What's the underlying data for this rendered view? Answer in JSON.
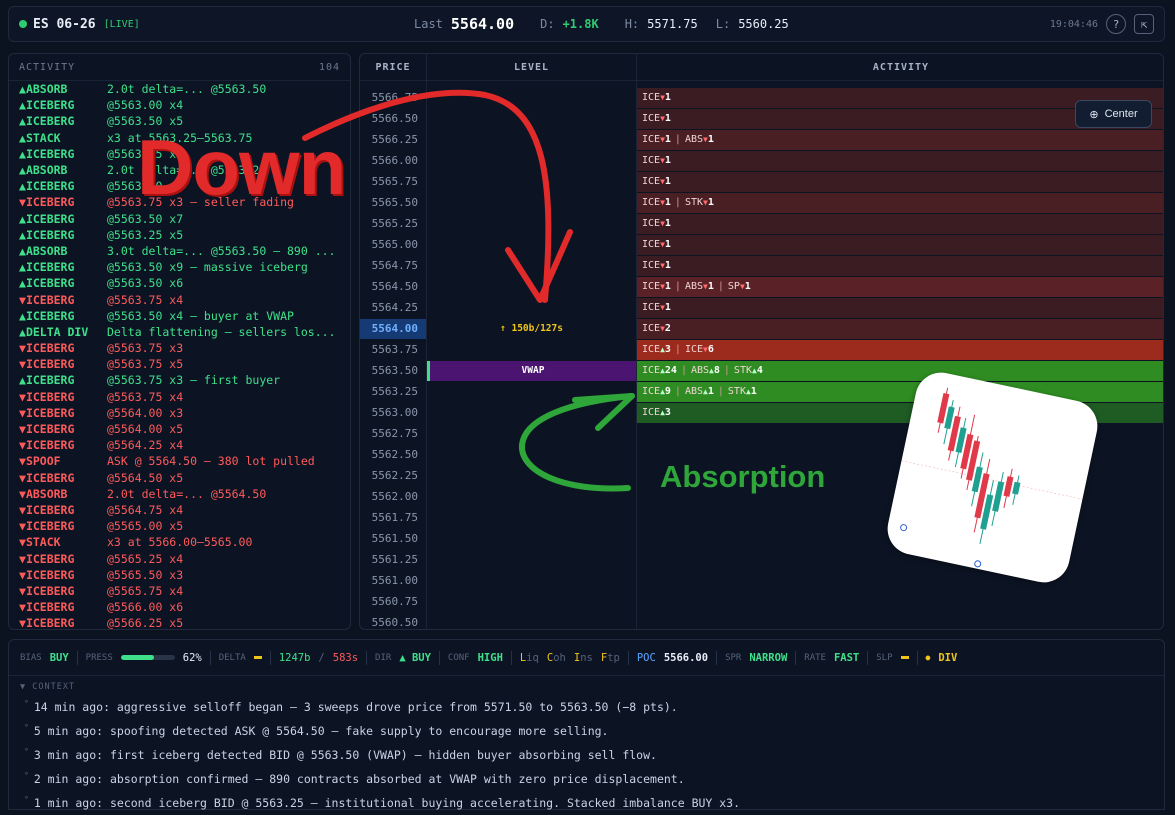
{
  "header": {
    "symbol": "ES 06-26",
    "live": "[LIVE]",
    "last_label": "Last",
    "last": "5564.00",
    "d_label": "D:",
    "d_value": "+1.8K",
    "h_label": "H:",
    "h_value": "5571.75",
    "l_label": "L:",
    "l_value": "5560.25",
    "time": "19:04:46",
    "help": "?",
    "popout": "⇱"
  },
  "activity": {
    "title": "ACTIVITY",
    "count": "104",
    "rows": [
      {
        "dir": "up",
        "type": "ABSORB",
        "text": "2.0t delta=... @5563.50"
      },
      {
        "dir": "up",
        "type": "ICEBERG",
        "text": "@5563.00 x4"
      },
      {
        "dir": "up",
        "type": "ICEBERG",
        "text": "@5563.50 x5"
      },
      {
        "dir": "up",
        "type": "STACK",
        "text": "x3 at 5563.25–5563.75"
      },
      {
        "dir": "up",
        "type": "ICEBERG",
        "text": "@5563.25 x7"
      },
      {
        "dir": "up",
        "type": "ABSORB",
        "text": "2.0t delta=... @5563.25"
      },
      {
        "dir": "up",
        "type": "ICEBERG",
        "text": "@5563.00 x6"
      },
      {
        "dir": "dn",
        "type": "ICEBERG",
        "text": "@5563.75 x3 — seller fading"
      },
      {
        "dir": "up",
        "type": "ICEBERG",
        "text": "@5563.50 x7"
      },
      {
        "dir": "up",
        "type": "ICEBERG",
        "text": "@5563.25 x5"
      },
      {
        "dir": "up",
        "type": "ABSORB",
        "text": "3.0t delta=... @5563.50 — 890 ..."
      },
      {
        "dir": "up",
        "type": "ICEBERG",
        "text": "@5563.50 x9 — massive iceberg"
      },
      {
        "dir": "up",
        "type": "ICEBERG",
        "text": "@5563.50 x6"
      },
      {
        "dir": "dn",
        "type": "ICEBERG",
        "text": "@5563.75 x4"
      },
      {
        "dir": "up",
        "type": "ICEBERG",
        "text": "@5563.50 x4 — buyer at VWAP"
      },
      {
        "dir": "up",
        "type": "DELTA DIV",
        "text": "Delta flattening — sellers los..."
      },
      {
        "dir": "dn",
        "type": "ICEBERG",
        "text": "@5563.75 x3"
      },
      {
        "dir": "dn",
        "type": "ICEBERG",
        "text": "@5563.75 x5"
      },
      {
        "dir": "up",
        "type": "ICEBERG",
        "text": "@5563.75 x3 — first buyer"
      },
      {
        "dir": "dn",
        "type": "ICEBERG",
        "text": "@5563.75 x4"
      },
      {
        "dir": "dn",
        "type": "ICEBERG",
        "text": "@5564.00 x3"
      },
      {
        "dir": "dn",
        "type": "ICEBERG",
        "text": "@5564.00 x5"
      },
      {
        "dir": "dn",
        "type": "ICEBERG",
        "text": "@5564.25 x4"
      },
      {
        "dir": "dn",
        "type": "SPOOF",
        "text": "ASK @ 5564.50 — 380 lot pulled"
      },
      {
        "dir": "dn",
        "type": "ICEBERG",
        "text": "@5564.50 x5"
      },
      {
        "dir": "dn",
        "type": "ABSORB",
        "text": "2.0t delta=... @5564.50"
      },
      {
        "dir": "dn",
        "type": "ICEBERG",
        "text": "@5564.75 x4"
      },
      {
        "dir": "dn",
        "type": "ICEBERG",
        "text": "@5565.00 x5"
      },
      {
        "dir": "dn",
        "type": "STACK",
        "text": "x3 at 5566.00–5565.00"
      },
      {
        "dir": "dn",
        "type": "ICEBERG",
        "text": "@5565.25 x4"
      },
      {
        "dir": "dn",
        "type": "ICEBERG",
        "text": "@5565.50 x3"
      },
      {
        "dir": "dn",
        "type": "ICEBERG",
        "text": "@5565.75 x4"
      },
      {
        "dir": "dn",
        "type": "ICEBERG",
        "text": "@5566.00 x6"
      },
      {
        "dir": "dn",
        "type": "ICEBERG",
        "text": "@5566.25 x5"
      }
    ]
  },
  "ladder": {
    "col_price": "PRICE",
    "col_level": "LEVEL",
    "col_activity": "ACTIVITY",
    "center_label": "Center",
    "rows": [
      {
        "price": "5566.75",
        "bg": "#3a1c22",
        "cells": [
          [
            "ICE",
            "dn",
            "1"
          ]
        ]
      },
      {
        "price": "5566.50",
        "bg": "#3a1c22",
        "cells": [
          [
            "ICE",
            "dn",
            "1"
          ]
        ]
      },
      {
        "price": "5566.25",
        "bg": "#4a1f24",
        "cells": [
          [
            "ICE",
            "dn",
            "1"
          ],
          [
            "ABS",
            "dn",
            "1"
          ]
        ]
      },
      {
        "price": "5566.00",
        "bg": "#3a1c22",
        "cells": [
          [
            "ICE",
            "dn",
            "1"
          ]
        ]
      },
      {
        "price": "5565.75",
        "bg": "#3a1c22",
        "cells": [
          [
            "ICE",
            "dn",
            "1"
          ]
        ]
      },
      {
        "price": "5565.50",
        "bg": "#4a1f24",
        "cells": [
          [
            "ICE",
            "dn",
            "1"
          ],
          [
            "STK",
            "dn",
            "1"
          ]
        ]
      },
      {
        "price": "5565.25",
        "bg": "#3a1c22",
        "cells": [
          [
            "ICE",
            "dn",
            "1"
          ]
        ]
      },
      {
        "price": "5565.00",
        "bg": "#3a1c22",
        "cells": [
          [
            "ICE",
            "dn",
            "1"
          ]
        ]
      },
      {
        "price": "5564.75",
        "bg": "#3a1c22",
        "cells": [
          [
            "ICE",
            "dn",
            "1"
          ]
        ]
      },
      {
        "price": "5564.50",
        "bg": "#5a2226",
        "cells": [
          [
            "ICE",
            "dn",
            "1"
          ],
          [
            "ABS",
            "dn",
            "1"
          ],
          [
            "SP",
            "dn",
            "1"
          ]
        ]
      },
      {
        "price": "5564.25",
        "bg": "#3a1c22",
        "cells": [
          [
            "ICE",
            "dn",
            "1"
          ]
        ]
      },
      {
        "price": "5564.00",
        "bg": "#4a1f24",
        "current": true,
        "level": "↑ 150b/127s",
        "cells": [
          [
            "ICE",
            "dn",
            "2"
          ]
        ]
      },
      {
        "price": "5563.75",
        "bg": "#9c2b1e",
        "cells": [
          [
            "ICE",
            "up",
            "3"
          ],
          [
            "ICE",
            "dn",
            "6"
          ]
        ]
      },
      {
        "price": "5563.50",
        "bg": "#2f8c22",
        "level": "VWAP",
        "cells": [
          [
            "ICE",
            "up",
            "24"
          ],
          [
            "ABS",
            "up",
            "8"
          ],
          [
            "STK",
            "up",
            "4"
          ]
        ]
      },
      {
        "price": "5563.25",
        "bg": "#2f8c22",
        "cells": [
          [
            "ICE",
            "up",
            "9"
          ],
          [
            "ABS",
            "up",
            "1"
          ],
          [
            "STK",
            "up",
            "1"
          ]
        ]
      },
      {
        "price": "5563.00",
        "bg": "#1e5c24",
        "cells": [
          [
            "ICE",
            "up",
            "3"
          ]
        ]
      },
      {
        "price": "5562.75",
        "bg": "",
        "cells": []
      },
      {
        "price": "5562.50",
        "bg": "",
        "cells": []
      },
      {
        "price": "5562.25",
        "bg": "",
        "cells": []
      },
      {
        "price": "5562.00",
        "bg": "",
        "cells": []
      },
      {
        "price": "5561.75",
        "bg": "",
        "cells": []
      },
      {
        "price": "5561.50",
        "bg": "",
        "cells": []
      },
      {
        "price": "5561.25",
        "bg": "",
        "cells": []
      },
      {
        "price": "5561.00",
        "bg": "",
        "cells": []
      },
      {
        "price": "5560.75",
        "bg": "",
        "cells": []
      },
      {
        "price": "5560.50",
        "bg": "",
        "cells": []
      }
    ]
  },
  "status": {
    "bias_l": "BIAS",
    "bias": "BUY",
    "press_l": "PRESS",
    "press": "62%",
    "press_fraction": 0.62,
    "delta_l": "DELTA",
    "delta_v": "1247b",
    "delta_slash": "/",
    "delta_s": "583s",
    "dir_l": "DIR",
    "dir": "▲ BUY",
    "conf_l": "CONF",
    "conf": "HIGH",
    "liq": "Liq",
    "coh": "Coh",
    "ins": "Ins",
    "ftp": "Ftp",
    "poc_l": "POC",
    "poc": "5566.00",
    "spr_l": "SPR",
    "spr": "NARROW",
    "rate_l": "RATE",
    "rate": "FAST",
    "slp_l": "SLP",
    "div": "DIV"
  },
  "context": {
    "title": "▼ CONTEXT",
    "lines": [
      "14 min ago: aggressive selloff began — 3 sweeps drove price from 5571.50 to 5563.50 (−8 pts).",
      "5 min ago: spoofing detected ASK @ 5564.50 — fake supply to encourage more selling.",
      "3 min ago: first iceberg detected BID @ 5563.50 (VWAP) — hidden buyer absorbing sell flow.",
      "2 min ago: absorption confirmed — 890 contracts absorbed at VWAP with zero price displacement.",
      "1 min ago: second iceberg BID @ 5563.25 — institutional buying accelerating. Stacked imbalance BUY x3."
    ]
  },
  "annotations": {
    "down": "Down",
    "absorption": "Absorption"
  },
  "colors": {
    "up": "#3fe08a",
    "down": "#ff5a5a",
    "accent": "#58a6ff"
  }
}
